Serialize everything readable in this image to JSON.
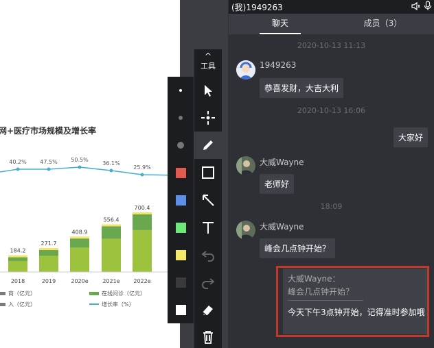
{
  "chat": {
    "title": "(我)1949263",
    "icons": [
      "speaker-icon",
      "microphone-icon"
    ],
    "tabs": [
      {
        "label": "聊天",
        "active": true
      },
      {
        "label": "成员（3）",
        "active": false
      }
    ],
    "timestamps": [
      "2020-10-13 11:13",
      "2020-10-13 16:06",
      "18:09"
    ],
    "messages": [
      {
        "sender": "1949263",
        "text": "恭喜发财，大吉大利"
      },
      {
        "sender": "self",
        "text": "大家好"
      },
      {
        "sender": "大威Wayne",
        "text": "老师好"
      },
      {
        "sender": "大威Wayne",
        "text": "峰会几点钟开始？"
      }
    ],
    "quote_reply": {
      "quoted_name": "大威Wayne：",
      "quoted_text": "峰会几点钟开始？",
      "reply": "今天下午3点钟开始，记得准时参加哦"
    }
  },
  "toolbar": {
    "label": "工具",
    "tools": [
      "cursor-icon",
      "laser-pointer-icon",
      "pen-icon",
      "rectangle-icon",
      "arrow-icon",
      "text-icon",
      "undo-icon",
      "redo-icon",
      "eraser-icon",
      "trash-icon"
    ],
    "active_tool": "pen-icon"
  },
  "palette": {
    "sizes": [
      "small",
      "medium",
      "large"
    ],
    "colors": [
      "#e05a4f",
      "#5b8fe8",
      "#6ee87a",
      "#f5e96a",
      "#3a3a3a",
      "#ffffff"
    ]
  },
  "chart_data": {
    "type": "bar",
    "title": "网+医疗市场规模及增长率",
    "categories": [
      "2018",
      "2019",
      "2020e",
      "2021e",
      "2022e"
    ],
    "series": [
      {
        "name": "",
        "values": [
          184.2,
          271.7,
          408.9,
          556.4,
          700.4
        ]
      }
    ],
    "growth_rate": [
      "40.2%",
      "47.5%",
      "50.5%",
      "36.1%",
      "25.9%"
    ],
    "legend": [
      "商（亿元）",
      "在线问诊（亿元）",
      "入（亿元）",
      "增长率（%）"
    ],
    "colors": {
      "bar": "#9dc23e",
      "bar_dark": "#6aa84f",
      "bar_top": "#f3e46b",
      "line": "#45b0cf"
    }
  }
}
